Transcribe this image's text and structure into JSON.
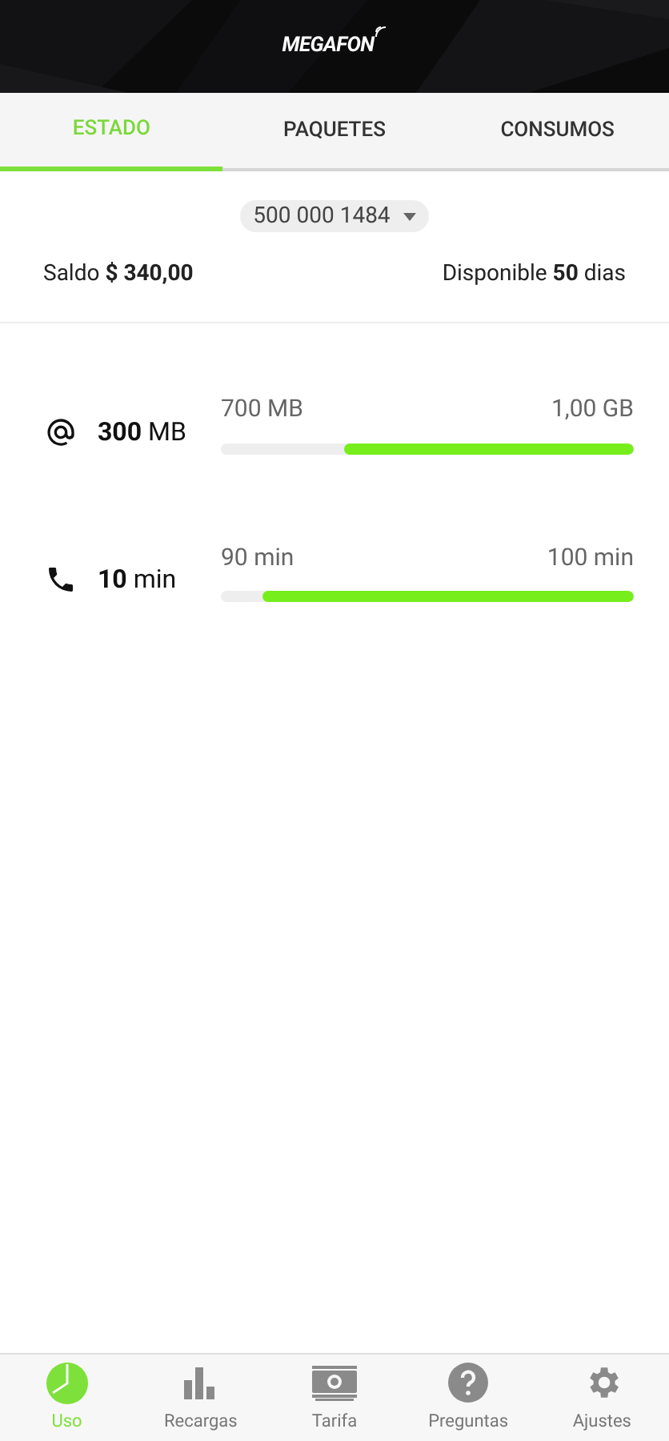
{
  "header": {
    "logo": "MEGAFON"
  },
  "tabs": [
    {
      "label": "ESTADO",
      "selected": true
    },
    {
      "label": "PAQUETES",
      "selected": false
    },
    {
      "label": "CONSUMOS",
      "selected": false
    }
  ],
  "line_selector": {
    "value": "500 000 1484"
  },
  "balance": {
    "label": "Saldo",
    "amount": "$ 340,00"
  },
  "validity": {
    "label": "Disponible",
    "days": "50",
    "unit": "dias"
  },
  "usage": [
    {
      "kind": "data",
      "amount": "300",
      "unit": "MB",
      "remaining": "700 MB",
      "total": "1,00 GB",
      "level": 0.7
    },
    {
      "kind": "voice",
      "amount": "10",
      "unit": "min",
      "remaining": "90 min",
      "total": "100 min",
      "level": 0.9
    }
  ],
  "bottom_nav": [
    {
      "kind": "pie",
      "label": "Uso",
      "selected": true
    },
    {
      "kind": "bars",
      "label": "Recargas",
      "selected": false
    },
    {
      "kind": "money",
      "label": "Tarifa",
      "selected": false
    },
    {
      "kind": "help",
      "label": "Preguntas",
      "selected": false
    },
    {
      "kind": "gear",
      "label": "Ajustes",
      "selected": false
    }
  ]
}
